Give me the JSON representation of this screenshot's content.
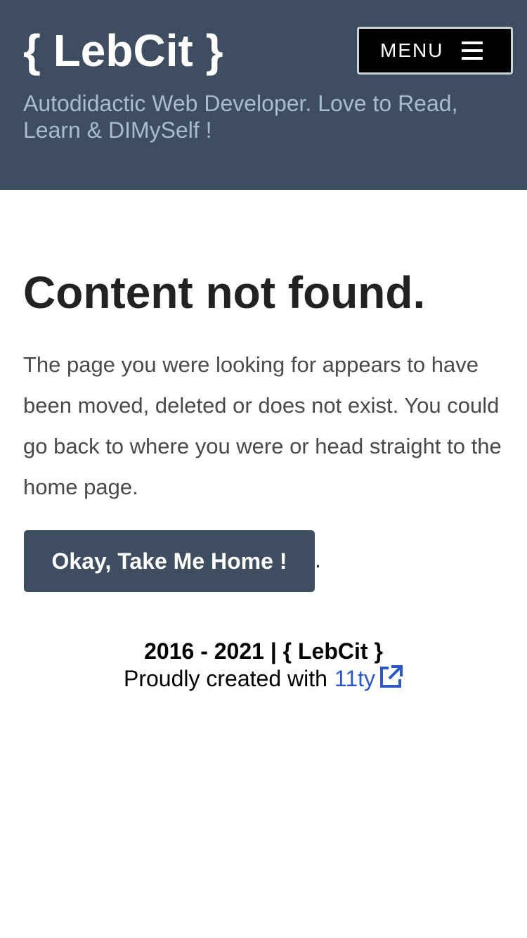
{
  "header": {
    "site_title": "{ LebCit }",
    "tagline": "Autodidactic Web Developer. Love to Read, Learn & DIMySelf !",
    "menu_label": "MENU",
    "menu_icon": "hamburger-icon"
  },
  "main": {
    "heading": "Content not found.",
    "paragraph": "The page you were looking for appears to have been moved, deleted or does not exist. You could go back to where you were or head straight to the home page.",
    "home_button_label": "Okay, Take Me Home !",
    "trailing_period": "."
  },
  "footer": {
    "copyright": "2016 - 2021 | { LebCit }",
    "created_with": "Proudly created with",
    "link_label": "11ty",
    "link_icon": "external-link-icon"
  },
  "colors": {
    "header_bg": "#3e4e60",
    "tagline": "#a9bccd",
    "button_bg": "#3e4e60",
    "link": "#2b57c8"
  }
}
